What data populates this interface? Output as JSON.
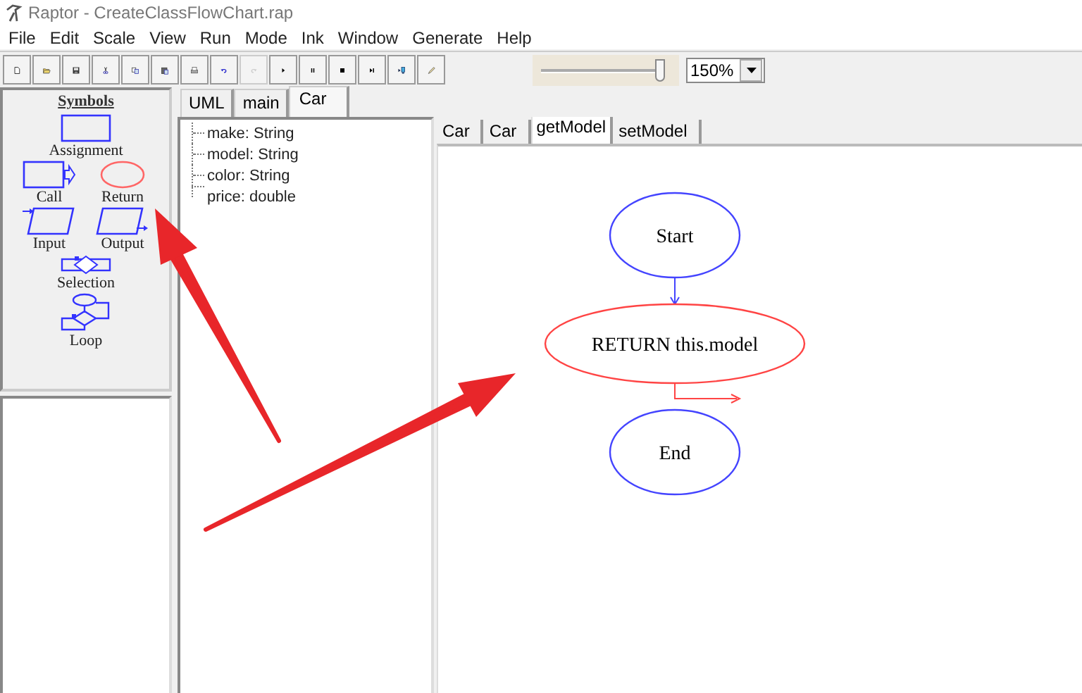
{
  "window": {
    "title": "Raptor - CreateClassFlowChart.rap"
  },
  "menu": [
    "File",
    "Edit",
    "Scale",
    "View",
    "Run",
    "Mode",
    "Ink",
    "Window",
    "Generate",
    "Help"
  ],
  "toolbar": [
    {
      "kind": "new",
      "disabled": false
    },
    {
      "kind": "open",
      "disabled": false
    },
    {
      "kind": "save",
      "disabled": false
    },
    {
      "kind": "cut",
      "disabled": false
    },
    {
      "kind": "copy",
      "disabled": false
    },
    {
      "kind": "paste",
      "disabled": false
    },
    {
      "kind": "print",
      "disabled": false
    },
    {
      "kind": "undo",
      "disabled": false
    },
    {
      "kind": "redo",
      "disabled": true
    },
    {
      "kind": "run",
      "disabled": false
    },
    {
      "kind": "pause",
      "disabled": false
    },
    {
      "kind": "stop",
      "disabled": false
    },
    {
      "kind": "step",
      "disabled": false
    },
    {
      "kind": "monitor",
      "disabled": false
    },
    {
      "kind": "pen",
      "disabled": false
    }
  ],
  "zoom": {
    "level": 1.0,
    "value": "150%"
  },
  "symbols": {
    "title": "Symbols",
    "items": [
      {
        "kind": "assignment",
        "label": "Assignment"
      },
      {
        "kind": "call",
        "label": "Call"
      },
      {
        "kind": "return",
        "label": "Return"
      },
      {
        "kind": "input",
        "label": "Input"
      },
      {
        "kind": "output",
        "label": "Output"
      },
      {
        "kind": "selection",
        "label": "Selection"
      },
      {
        "kind": "loop",
        "label": "Loop"
      }
    ]
  },
  "class_tabs": [
    {
      "label": "UML",
      "selected": false
    },
    {
      "label": "main",
      "selected": false
    },
    {
      "label": "Car",
      "selected": true
    }
  ],
  "attributes": [
    "make: String",
    "model: String",
    "color: String",
    "price: double"
  ],
  "method_tabs": [
    {
      "label": "Car",
      "selected": false
    },
    {
      "label": "Car",
      "selected": false
    },
    {
      "label": "getModel",
      "selected": true
    },
    {
      "label": "setModel",
      "selected": false
    }
  ],
  "flowchart": {
    "nodes": [
      {
        "kind": "start",
        "label": "Start",
        "selected": false
      },
      {
        "kind": "return",
        "label": "RETURN this.model",
        "selected": true
      },
      {
        "kind": "end",
        "label": "End",
        "selected": false
      }
    ]
  }
}
